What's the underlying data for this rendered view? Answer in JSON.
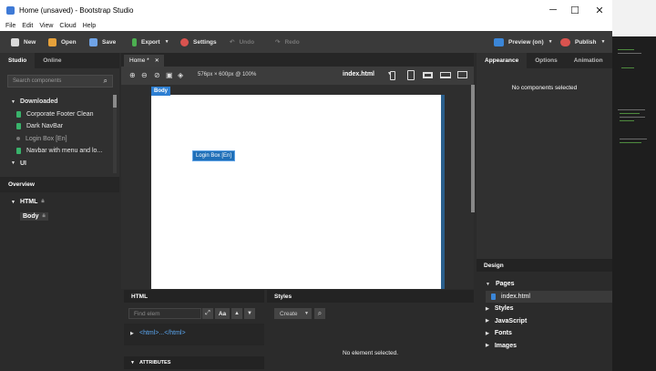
{
  "window": {
    "title": "Home (unsaved) - Bootstrap Studio",
    "controls": {
      "minimize": "─",
      "maximize": "☐",
      "close": "✕"
    }
  },
  "menu": [
    "File",
    "Edit",
    "View",
    "Cloud",
    "Help"
  ],
  "toolbar": {
    "new": "New",
    "open": "Open",
    "save": "Save",
    "export": "Export",
    "settings": "Settings",
    "undo": "Undo",
    "redo": "Redo",
    "preview": "Preview (on)",
    "publish": "Publish",
    "colors": {
      "new": "#d9d9d9",
      "open": "#e6a13a",
      "save": "#6fa3e6",
      "export": "#4caf50",
      "settings": "#d9534f",
      "preview": "#3b86d8",
      "publish": "#d9534f"
    }
  },
  "left": {
    "tabs": [
      "Studio",
      "Online"
    ],
    "search_placeholder": "Search components",
    "tree_groups": {
      "downloaded": "Downloaded",
      "ui": "UI"
    },
    "components": [
      {
        "label": "Corporate Footer Clean",
        "color": "#39b36b"
      },
      {
        "label": "Dark NavBar",
        "color": "#39b36b"
      },
      {
        "label": "Login Box [En]",
        "color": "#777777"
      },
      {
        "label": "Navbar with menu and lo...",
        "color": "#39b36b"
      }
    ],
    "overview": {
      "title": "Overview",
      "html": "HTML",
      "body": "Body"
    }
  },
  "editor": {
    "tab": "Home *",
    "size_label": "576px × 600px @ 100%",
    "file": "index.html",
    "body_tag": "Body",
    "selected_component": "Login Box [En]"
  },
  "html_panel": {
    "title": "HTML",
    "find_placeholder": "Find elem",
    "aa": "Aa",
    "root_node": "<html>...</html>",
    "attributes": "ATTRIBUTES"
  },
  "styles_panel": {
    "title": "Styles",
    "create": "Create",
    "empty": "No element selected."
  },
  "right": {
    "tabs": [
      "Appearance",
      "Options",
      "Animation"
    ],
    "empty": "No components selected",
    "design": {
      "title": "Design",
      "pages": "Pages",
      "page_file": "index.html",
      "sections": [
        "Styles",
        "JavaScript",
        "Fonts",
        "Images"
      ]
    }
  }
}
